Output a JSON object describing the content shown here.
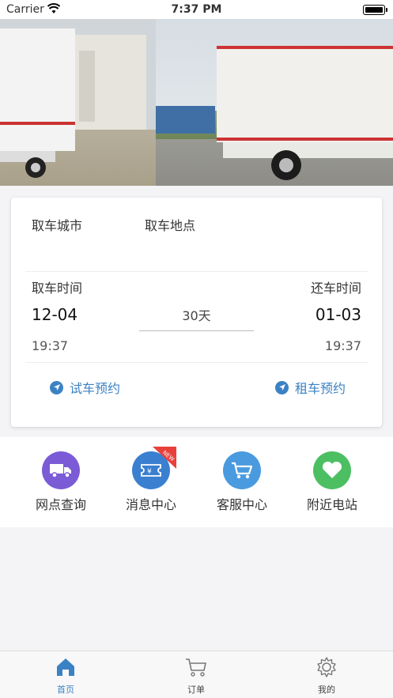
{
  "status": {
    "carrier": "Carrier",
    "time": "7:37 PM"
  },
  "rental": {
    "pickup_city_label": "取车城市",
    "pickup_location_label": "取车地点",
    "pickup_time_label": "取车时间",
    "return_time_label": "还车时间",
    "pickup_date": "12-04",
    "return_date": "01-03",
    "pickup_clock": "19:37",
    "return_clock": "19:37",
    "duration": "30天",
    "test_drive_label": "试车预约",
    "rent_label": "租车预约"
  },
  "quick_links": [
    {
      "label": "网点查询",
      "icon": "truck-icon",
      "color": "#7b5bd6"
    },
    {
      "label": "消息中心",
      "icon": "ticket-icon",
      "color": "#3b7fd1",
      "badge": "NEW"
    },
    {
      "label": "客服中心",
      "icon": "cart-icon",
      "color": "#4a9ae0"
    },
    {
      "label": "附近电站",
      "icon": "heart-icon",
      "color": "#4cbf63"
    }
  ],
  "tabbar": [
    {
      "label": "首页",
      "icon": "home-icon",
      "active": true
    },
    {
      "label": "订单",
      "icon": "cart-icon",
      "active": false
    },
    {
      "label": "我的",
      "icon": "gear-icon",
      "active": false
    }
  ],
  "colors": {
    "accent": "#3b82c4"
  }
}
